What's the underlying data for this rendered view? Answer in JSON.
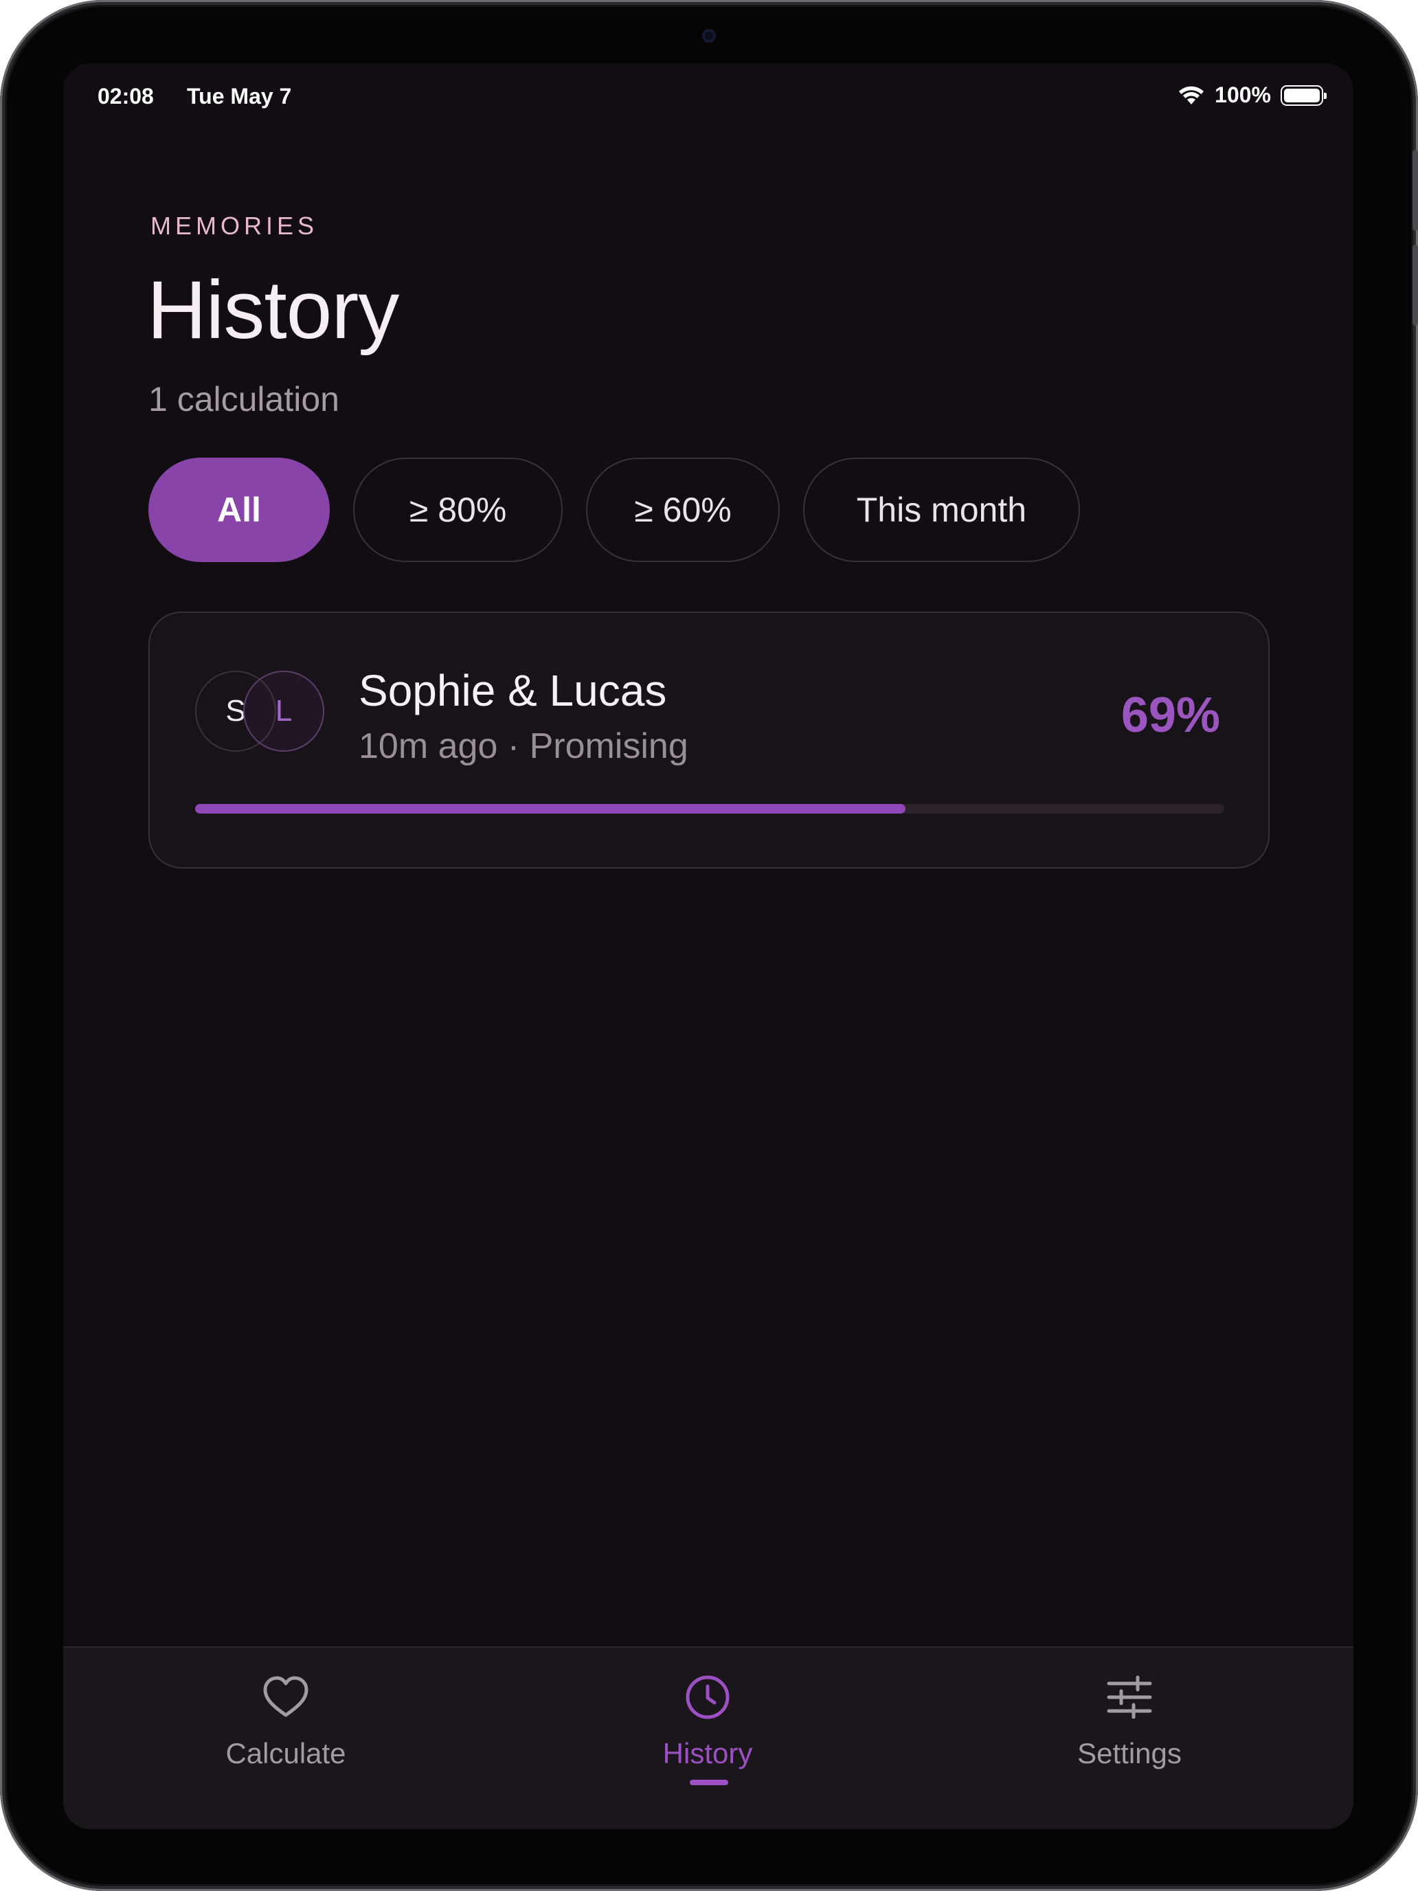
{
  "status_bar": {
    "time": "02:08",
    "date": "Tue May 7",
    "battery_text": "100%",
    "battery_level": 1.0,
    "wifi_icon": "wifi-icon"
  },
  "header": {
    "eyebrow": "MEMORIES",
    "title": "History",
    "subtitle": "1 calculation"
  },
  "filters": [
    {
      "label": "All",
      "active": true
    },
    {
      "label": "≥ 80%",
      "active": false
    },
    {
      "label": "≥ 60%",
      "active": false
    },
    {
      "label": "This month",
      "active": false
    }
  ],
  "history": [
    {
      "initial_a": "S",
      "initial_b": "L",
      "names": "Sophie & Lucas",
      "meta": "10m ago · Promising",
      "percent_label": "69%",
      "percent_value": 0.69
    }
  ],
  "tabbar": {
    "tabs": [
      {
        "label": "Calculate",
        "icon": "heart-icon",
        "active": false
      },
      {
        "label": "History",
        "icon": "clock-icon",
        "active": true
      },
      {
        "label": "Settings",
        "icon": "sliders-icon",
        "active": false
      }
    ]
  },
  "colors": {
    "accent": "#9b50c3",
    "chip_active": "#8844a8",
    "background": "#110d12",
    "eyebrow": "#e8b8cf"
  }
}
